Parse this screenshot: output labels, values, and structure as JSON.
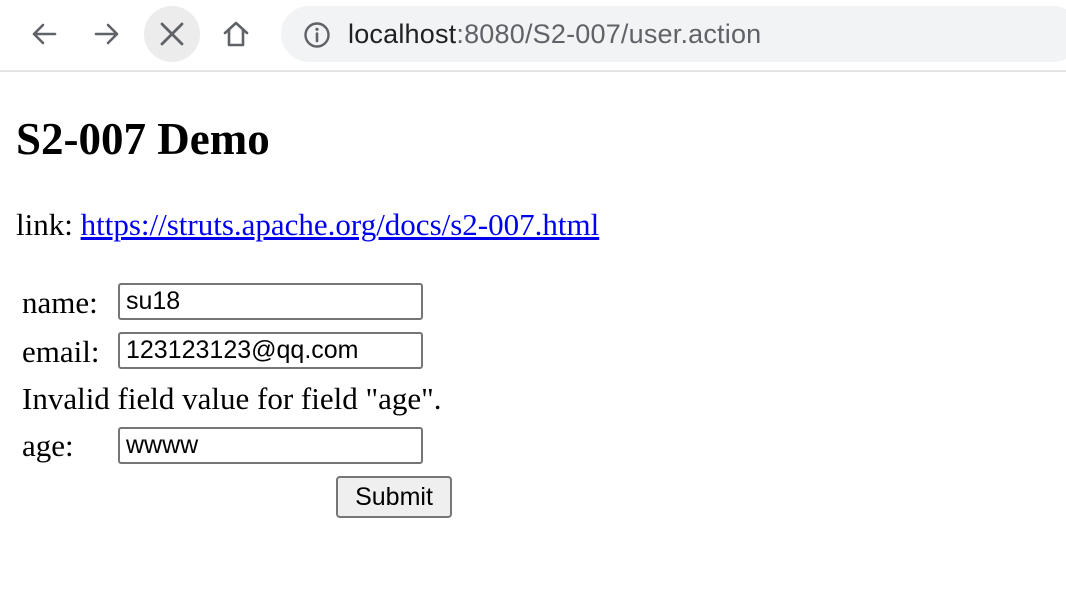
{
  "browser": {
    "url_host": "localhost",
    "url_path": ":8080/S2-007/user.action",
    "icons": {
      "back": "arrow-left",
      "forward": "arrow-right",
      "stop": "close-x",
      "home": "house",
      "site_info": "info-circle"
    }
  },
  "page": {
    "title": "S2-007 Demo",
    "link_label": "link:",
    "link_text": "https://struts.apache.org/docs/s2-007.html"
  },
  "form": {
    "name_label": "name:",
    "name_value": "su18",
    "email_label": "email:",
    "email_value": "123123123@qq.com",
    "error_message": "Invalid field value for field \"age\".",
    "age_label": "age:",
    "age_value": "wwww",
    "submit_label": "Submit"
  },
  "colors": {
    "link": "#0000ee",
    "omnibox_bg": "#f1f3f4"
  }
}
